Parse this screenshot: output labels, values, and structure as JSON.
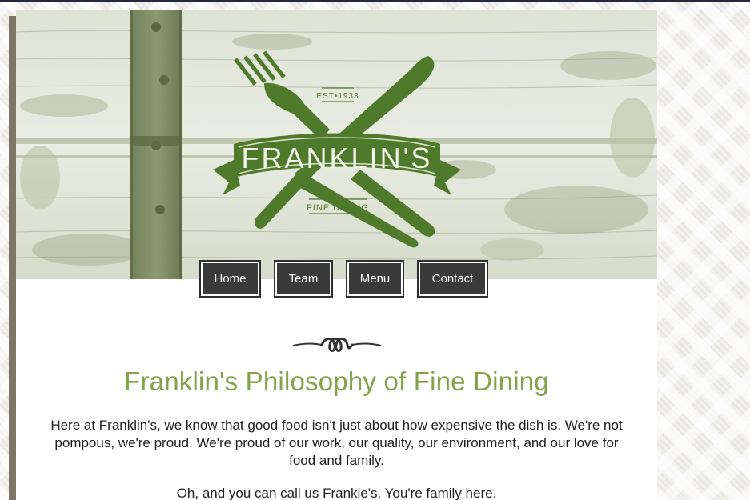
{
  "logo": {
    "name": "FRANKLIN'S",
    "established": "EST•1933",
    "tagline": "FINE DINING"
  },
  "nav": {
    "items": [
      {
        "label": "Home"
      },
      {
        "label": "Team"
      },
      {
        "label": "Menu"
      },
      {
        "label": "Contact"
      }
    ]
  },
  "main": {
    "title": "Franklin's Philosophy of Fine Dining",
    "paragraphs": [
      "Here at Franklin's, we know that good food isn't just about how expensive the dish is. We're not pompous, we're proud. We're proud of our work, our quality, our environment, and our love for food and family.",
      "Oh, and you can call us Frankie's. You're family here."
    ]
  },
  "colors": {
    "brand_green": "#4f7a2c",
    "title_green": "#82a346",
    "nav_bg": "#3a3a3a",
    "page_bg": "#ffffff",
    "shadow": "#7d7566"
  },
  "icons": {
    "logo_icons": [
      "fork-icon",
      "knife-icon",
      "ribbon-banner"
    ],
    "divider": "ornament-divider-icon"
  }
}
